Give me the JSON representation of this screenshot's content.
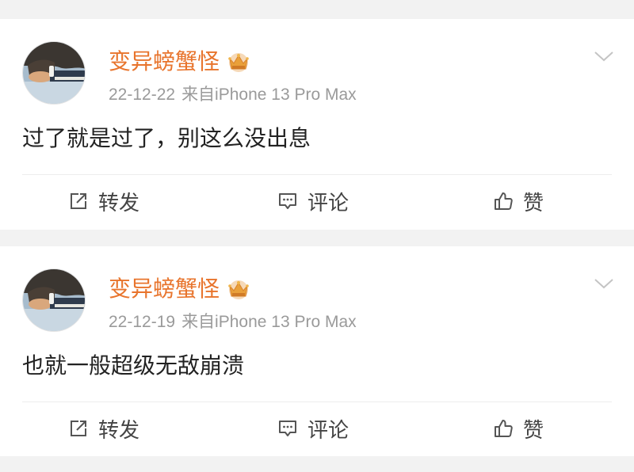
{
  "colors": {
    "background": "#f2f2f2",
    "card": "#ffffff",
    "username": "#e8742c",
    "meta": "#9a9a9a",
    "text": "#222222",
    "action": "#444444"
  },
  "posts": [
    {
      "username": "变异螃蟹怪",
      "badge_icon": "crown-badge-icon",
      "date": "22-12-22",
      "source": "来自iPhone 13 Pro Max",
      "text": "过了就是过了，别这么没出息",
      "actions": [
        {
          "label": "转发",
          "icon": "repost-icon"
        },
        {
          "label": "评论",
          "icon": "comment-icon"
        },
        {
          "label": "赞",
          "icon": "like-icon"
        }
      ]
    },
    {
      "username": "变异螃蟹怪",
      "badge_icon": "crown-badge-icon",
      "date": "22-12-19",
      "source": "来自iPhone 13 Pro Max",
      "text": "也就一般超级无敌崩溃",
      "actions": [
        {
          "label": "转发",
          "icon": "repost-icon"
        },
        {
          "label": "评论",
          "icon": "comment-icon"
        },
        {
          "label": "赞",
          "icon": "like-icon"
        }
      ]
    }
  ]
}
